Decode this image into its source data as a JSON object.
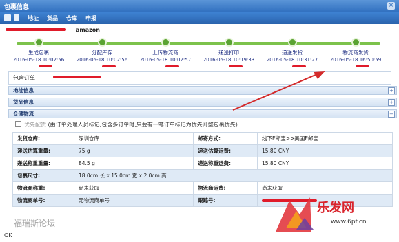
{
  "window": {
    "title": "包裹信息"
  },
  "nav": {
    "items": [
      "地址",
      "货品",
      "仓库",
      "申报"
    ]
  },
  "header": {
    "brand": "amazon"
  },
  "timeline": [
    {
      "label": "生成包裹",
      "time": "2016-05-18 10:02:56"
    },
    {
      "label": "分配库存",
      "time": "2016-05-18 10:02:56"
    },
    {
      "label": "上传物流商",
      "time": "2016-05-18 10:02:57"
    },
    {
      "label": "递送打印",
      "time": "2016-05-18 10:19:33"
    },
    {
      "label": "递送发货",
      "time": "2016-05-18 10:31:27"
    },
    {
      "label": "物流商发货",
      "time": "2016-05-18 16:50:59"
    }
  ],
  "order": {
    "label": "包含订单"
  },
  "sections": {
    "address": "地址信息",
    "goods": "货品信息",
    "warehouse": "仓储物流"
  },
  "priority": {
    "label": "优先配货",
    "note": "(由订单处理人员标记,包含多订单时,只要有一笔订单标记为优先则整包裹优先)"
  },
  "info_rows": [
    [
      "发货仓库:",
      "深圳仓库",
      "邮寄方式:",
      "线下E邮宝>>美国E邮宝"
    ],
    [
      "递送估算重量:",
      "75 g",
      "递送估算运费:",
      "15.80 CNY"
    ],
    [
      "递送称重重量:",
      "84.5 g",
      "递送称重运费:",
      "15.80 CNY"
    ],
    [
      "包裹尺寸:",
      "18.0cm 长 x 15.0cm 宽 x 2.0cm 高",
      "",
      ""
    ],
    [
      "物流商称重:",
      "尚未获取",
      "物流商运费:",
      "尚未获取"
    ],
    [
      "物流商单号:",
      "无物流商单号",
      "跟踪号:",
      ""
    ]
  ],
  "watermarks": {
    "forum": "福瑞斯论坛",
    "site_cn": "乐发网",
    "site_url": "www.6pf.cn"
  },
  "footer": {
    "button": "OK"
  },
  "colors": {
    "timeline_green": "#5aa332",
    "accent_blue": "#2f6fbf",
    "annotation_red": "#d42a2a"
  }
}
